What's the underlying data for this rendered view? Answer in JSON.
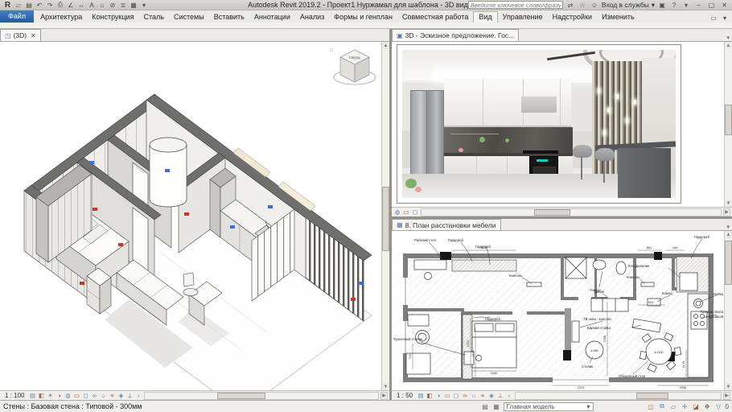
{
  "window": {
    "logo": "R",
    "title": "Autodesk Revit 2019.2 - Проект1 Нуржамал для шаблона - 3D вид (3D)",
    "search_placeholder": "Введите ключевое слово/фразу",
    "signin": "Вход в службы",
    "signin_caret": "▾",
    "qat": [
      {
        "name": "open-icon",
        "glyph": "▱"
      },
      {
        "name": "save-icon",
        "glyph": "▤"
      },
      {
        "name": "undo-icon",
        "glyph": "↶"
      },
      {
        "name": "redo-icon",
        "glyph": "↷"
      },
      {
        "name": "print-icon",
        "glyph": "⎙"
      },
      {
        "name": "measure-icon",
        "glyph": "∠"
      },
      {
        "name": "aligned-dimension-icon",
        "glyph": "↔"
      },
      {
        "name": "text-icon",
        "glyph": "A"
      },
      {
        "name": "default-3d-view-icon",
        "glyph": "⌂"
      },
      {
        "name": "section-icon",
        "glyph": "⊘"
      },
      {
        "name": "thin-lines-icon",
        "glyph": "≣"
      },
      {
        "name": "switch-windows-icon",
        "glyph": "▦"
      },
      {
        "name": "qat-customize-icon",
        "glyph": "▾"
      }
    ],
    "header_icons": [
      {
        "name": "communication-center-icon",
        "glyph": "⇄"
      },
      {
        "name": "favorites-icon",
        "glyph": "☆"
      },
      {
        "name": "sign-in-icon",
        "glyph": "☺"
      },
      {
        "name": "app-store-icon",
        "glyph": "▣"
      },
      {
        "name": "help-icon",
        "glyph": "?"
      },
      {
        "name": "help-caret-icon",
        "glyph": "▾"
      }
    ],
    "window_buttons": [
      {
        "name": "minimize-button",
        "glyph": "–"
      },
      {
        "name": "restore-button",
        "glyph": "▢"
      },
      {
        "name": "close-button",
        "glyph": "✕"
      }
    ]
  },
  "ribbon": {
    "file_tab": "Файл",
    "tabs": [
      "Архитектура",
      "Конструкция",
      "Сталь",
      "Системы",
      "Вставить",
      "Аннотации",
      "Анализ",
      "Формы и генплан",
      "Совместная работа",
      "Вид",
      "Управление",
      "Надстройки",
      "Изменить"
    ],
    "collapse_icon": "▭",
    "collapse_caret": "▾"
  },
  "panes": {
    "left": {
      "icon": "◳",
      "tab": "(3D)",
      "close": "✕",
      "scale": "1 : 100"
    },
    "top_right": {
      "icon": "▣",
      "tab": "3D - Эскизное предложение. Гос...",
      "menu": "▾"
    },
    "bottom_right": {
      "icon": "▦",
      "tab": "8. План расстановки мебели",
      "menu": "▾",
      "scale": "1 : 50"
    }
  },
  "viewcube": {
    "home": "⌂",
    "top": "Сверху"
  },
  "viewbar_icons": [
    {
      "name": "detail-level-icon",
      "glyph": "▤"
    },
    {
      "name": "visual-style-icon",
      "glyph": "◧"
    },
    {
      "name": "sun-path-icon",
      "glyph": "☀"
    },
    {
      "name": "shadows-icon",
      "glyph": "◑"
    },
    {
      "name": "render-icon",
      "glyph": "◍"
    },
    {
      "name": "crop-view-icon",
      "glyph": "▭"
    },
    {
      "name": "crop-region-icon",
      "glyph": "◻"
    },
    {
      "name": "hide-isolate-icon",
      "glyph": "∞"
    },
    {
      "name": "reveal-hidden-icon",
      "glyph": "☼"
    },
    {
      "name": "view-properties-icon",
      "glyph": "≡"
    },
    {
      "name": "displaced-elements-icon",
      "glyph": "◈"
    },
    {
      "name": "constraints-icon",
      "glyph": "⊥"
    },
    {
      "name": "collapse-icon",
      "glyph": "‹"
    }
  ],
  "render_viewbar_icons": [
    {
      "name": "render-dialog-icon",
      "glyph": "◍"
    },
    {
      "name": "crop-view-icon",
      "glyph": "▭"
    },
    {
      "name": "crop-region-icon",
      "glyph": "◻"
    }
  ],
  "status_bar": {
    "selection_text": "Стены : Базовая стена : Типовой - 300мм",
    "worksets_icon": "▤",
    "design_options_icon": "▦",
    "model_selector": "Главная модель",
    "model_caret": "▾",
    "right_icons": [
      {
        "name": "worksharing-display-icon",
        "glyph": "◫"
      },
      {
        "name": "select-links-icon",
        "glyph": "⧉"
      },
      {
        "name": "select-underlay-icon",
        "glyph": "▱"
      },
      {
        "name": "select-pinned-icon",
        "glyph": "✛"
      },
      {
        "name": "select-by-face-icon",
        "glyph": "◪"
      },
      {
        "name": "drag-on-selection-icon",
        "glyph": "✥"
      },
      {
        "name": "filter-icon",
        "glyph": "▽"
      }
    ],
    "filter_count": "0"
  },
  "plan": {
    "labels": [
      {
        "text": "Рабочий стол"
      },
      {
        "text": "Гардероб"
      },
      {
        "text": "Гардероб"
      },
      {
        "text": "Консоль"
      },
      {
        "text": "Консоль"
      },
      {
        "text": "Унитаз"
      },
      {
        "text": "Гардероб"
      },
      {
        "text": "Холодильник"
      },
      {
        "text": "Мойка"
      },
      {
        "text": "Газовая плита"
      },
      {
        "text": "с духовкой"
      },
      {
        "text": "Диван"
      },
      {
        "text": "Комод"
      },
      {
        "text": "Барная стойка"
      },
      {
        "text": "ТВ зона - консоль"
      },
      {
        "text": "Гардероб"
      },
      {
        "text": "Туалетный столик"
      },
      {
        "text": "Столик"
      },
      {
        "text": "Обеденный стол"
      },
      {
        "text": "ø 1100"
      },
      {
        "text": "ø 980"
      }
    ],
    "dims": [
      "2113",
      "1132",
      "2000",
      "713",
      "2258",
      "1134",
      "904",
      "1149",
      "862",
      "446",
      "1570",
      "2556"
    ]
  }
}
